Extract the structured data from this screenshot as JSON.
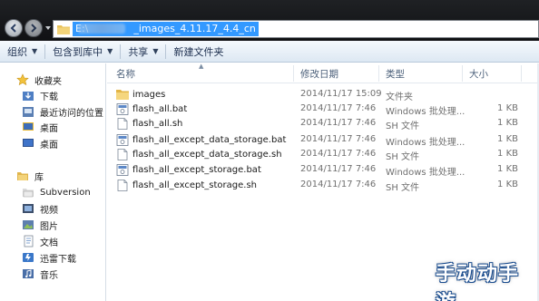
{
  "address": {
    "path_prefix": "E:\\",
    "path_suffix": "_images_4.11.17_4.4_cn"
  },
  "toolbar": {
    "organize": "组织",
    "include_in_library": "包含到库中",
    "share": "共享",
    "new_folder": "新建文件夹"
  },
  "nav": {
    "favorites": "收藏夹",
    "downloads": "下载",
    "recent": "最近访问的位置",
    "desktop1": "桌面",
    "desktop2": "桌面",
    "libraries": "库",
    "subversion": "Subversion",
    "videos": "视频",
    "pictures": "图片",
    "documents": "文档",
    "thunder": "迅雷下载",
    "music": "音乐"
  },
  "columns": {
    "name": "名称",
    "date": "修改日期",
    "type": "类型",
    "size": "大小"
  },
  "files": [
    {
      "name": "images",
      "date": "2014/11/17 15:09",
      "type": "文件夹",
      "size": "",
      "icon": "folder-icon"
    },
    {
      "name": "flash_all.bat",
      "date": "2014/11/17 7:46",
      "type": "Windows 批处理...",
      "size": "1 KB",
      "icon": "bat-file-icon"
    },
    {
      "name": "flash_all.sh",
      "date": "2014/11/17 7:46",
      "type": "SH 文件",
      "size": "1 KB",
      "icon": "file-icon"
    },
    {
      "name": "flash_all_except_data_storage.bat",
      "date": "2014/11/17 7:46",
      "type": "Windows 批处理...",
      "size": "1 KB",
      "icon": "bat-file-icon"
    },
    {
      "name": "flash_all_except_data_storage.sh",
      "date": "2014/11/17 7:46",
      "type": "SH 文件",
      "size": "1 KB",
      "icon": "file-icon"
    },
    {
      "name": "flash_all_except_storage.bat",
      "date": "2014/11/17 7:46",
      "type": "Windows 批处理...",
      "size": "1 KB",
      "icon": "bat-file-icon"
    },
    {
      "name": "flash_all_except_storage.sh",
      "date": "2014/11/17 7:46",
      "type": "SH 文件",
      "size": "1 KB",
      "icon": "file-icon"
    }
  ],
  "watermark": "手动动手游",
  "colors": {
    "selection": "#3399ff",
    "toolbar_text": "#1e3050",
    "header_text": "#4c607a"
  }
}
